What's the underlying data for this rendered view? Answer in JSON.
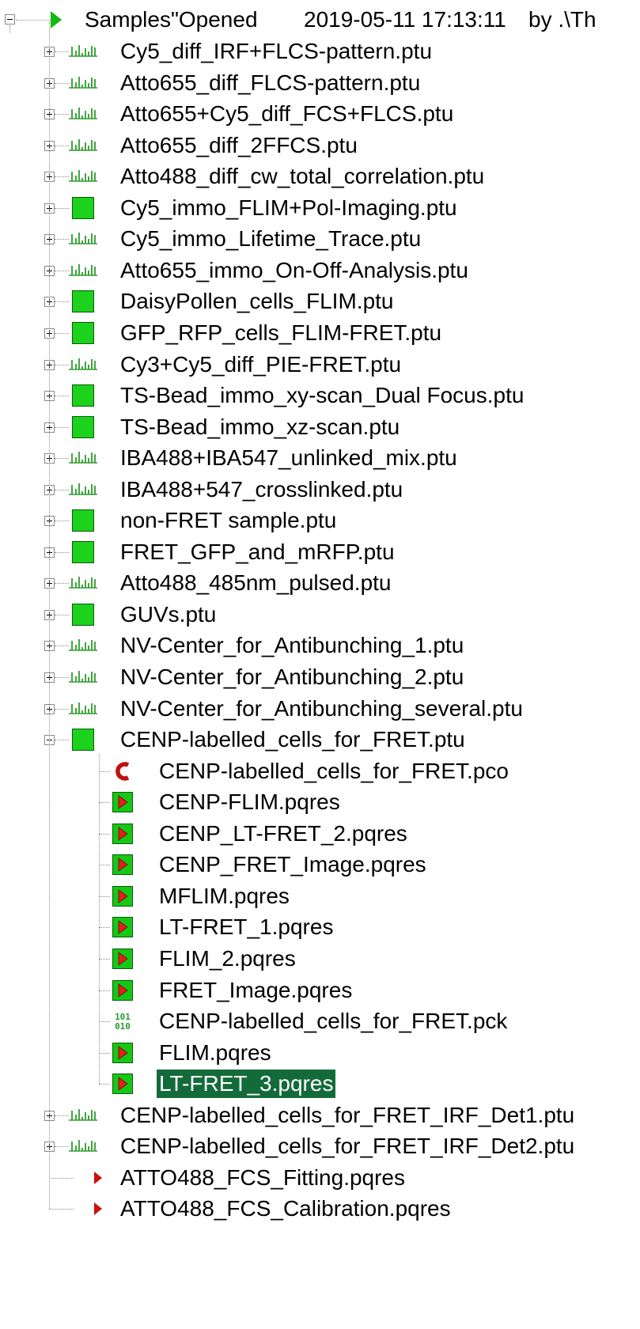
{
  "colors": {
    "selection_bg": "#146b3a",
    "tree_lines": "#8a8a8a",
    "result_icon_green": "#14c814",
    "result_icon_red": "#e02020",
    "histogram_green": "#2e9b2e",
    "image_green": "#1cd21c",
    "chart_c_red": "#c01010"
  },
  "header": {
    "title": "Samples\"Opened",
    "datetime": "2019-05-11 17:13:11",
    "by": "by .\\Th",
    "icon": "play-triangle-icon",
    "expanded": true
  },
  "items": [
    {
      "label": "Cy5_diff_IRF+FLCS-pattern.ptu",
      "icon": "histogram-icon",
      "expandable": true,
      "expanded": false
    },
    {
      "label": "Atto655_diff_FLCS-pattern.ptu",
      "icon": "histogram-icon",
      "expandable": true,
      "expanded": false
    },
    {
      "label": "Atto655+Cy5_diff_FCS+FLCS.ptu",
      "icon": "histogram-icon",
      "expandable": true,
      "expanded": false
    },
    {
      "label": "Atto655_diff_2FFCS.ptu",
      "icon": "histogram-icon",
      "expandable": true,
      "expanded": false
    },
    {
      "label": "Atto488_diff_cw_total_correlation.ptu",
      "icon": "histogram-icon",
      "expandable": true,
      "expanded": false
    },
    {
      "label": "Cy5_immo_FLIM+Pol-Imaging.ptu",
      "icon": "image-square-icon",
      "expandable": true,
      "expanded": false
    },
    {
      "label": "Cy5_immo_Lifetime_Trace.ptu",
      "icon": "histogram-icon",
      "expandable": true,
      "expanded": false
    },
    {
      "label": "Atto655_immo_On-Off-Analysis.ptu",
      "icon": "histogram-icon",
      "expandable": true,
      "expanded": false
    },
    {
      "label": "DaisyPollen_cells_FLIM.ptu",
      "icon": "image-square-icon",
      "expandable": true,
      "expanded": false
    },
    {
      "label": "GFP_RFP_cells_FLIM-FRET.ptu",
      "icon": "image-square-icon",
      "expandable": true,
      "expanded": false
    },
    {
      "label": "Cy3+Cy5_diff_PIE-FRET.ptu",
      "icon": "histogram-icon",
      "expandable": true,
      "expanded": false
    },
    {
      "label": "TS-Bead_immo_xy-scan_Dual Focus.ptu",
      "icon": "image-square-icon",
      "expandable": true,
      "expanded": false
    },
    {
      "label": "TS-Bead_immo_xz-scan.ptu",
      "icon": "image-square-icon",
      "expandable": true,
      "expanded": false
    },
    {
      "label": "IBA488+IBA547_unlinked_mix.ptu",
      "icon": "histogram-icon",
      "expandable": true,
      "expanded": false
    },
    {
      "label": "IBA488+547_crosslinked.ptu",
      "icon": "histogram-icon",
      "expandable": true,
      "expanded": false
    },
    {
      "label": "non-FRET sample.ptu",
      "icon": "image-square-icon",
      "expandable": true,
      "expanded": false
    },
    {
      "label": "FRET_GFP_and_mRFP.ptu",
      "icon": "image-square-icon",
      "expandable": true,
      "expanded": false
    },
    {
      "label": "Atto488_485nm_pulsed.ptu",
      "icon": "histogram-icon",
      "expandable": true,
      "expanded": false
    },
    {
      "label": "GUVs.ptu",
      "icon": "image-square-icon",
      "expandable": true,
      "expanded": false
    },
    {
      "label": "NV-Center_for_Antibunching_1.ptu",
      "icon": "histogram-icon",
      "expandable": true,
      "expanded": false
    },
    {
      "label": "NV-Center_for_Antibunching_2.ptu",
      "icon": "histogram-icon",
      "expandable": true,
      "expanded": false
    },
    {
      "label": "NV-Center_for_Antibunching_several.ptu",
      "icon": "histogram-icon",
      "expandable": true,
      "expanded": false
    },
    {
      "label": "CENP-labelled_cells_for_FRET.ptu",
      "icon": "image-square-icon",
      "expandable": true,
      "expanded": true,
      "children": [
        {
          "label": "CENP-labelled_cells_for_FRET.pco",
          "icon": "chart-c-icon"
        },
        {
          "label": "CENP-FLIM.pqres",
          "icon": "result-play-icon"
        },
        {
          "label": "CENP_LT-FRET_2.pqres",
          "icon": "result-play-icon"
        },
        {
          "label": "CENP_FRET_Image.pqres",
          "icon": "result-play-icon"
        },
        {
          "label": "MFLIM.pqres",
          "icon": "result-play-icon"
        },
        {
          "label": "LT-FRET_1.pqres",
          "icon": "result-play-icon"
        },
        {
          "label": "FLIM_2.pqres",
          "icon": "result-play-icon"
        },
        {
          "label": "FRET_Image.pqres",
          "icon": "result-play-icon"
        },
        {
          "label": "CENP-labelled_cells_for_FRET.pck",
          "icon": "binary-icon",
          "binary_text": [
            "101",
            "010"
          ]
        },
        {
          "label": "FLIM.pqres",
          "icon": "result-play-icon"
        },
        {
          "label": "LT-FRET_3.pqres",
          "icon": "result-play-icon",
          "selected": true
        }
      ]
    },
    {
      "label": "CENP-labelled_cells_for_FRET_IRF_Det1.ptu",
      "icon": "histogram-icon",
      "expandable": true,
      "expanded": false
    },
    {
      "label": "CENP-labelled_cells_for_FRET_IRF_Det2.ptu",
      "icon": "histogram-icon",
      "expandable": true,
      "expanded": false
    },
    {
      "label": "ATTO488_FCS_Fitting.pqres",
      "icon": "small-red-arrow-icon",
      "expandable": false
    },
    {
      "label": "ATTO488_FCS_Calibration.pqres",
      "icon": "small-red-arrow-icon",
      "expandable": false
    }
  ]
}
